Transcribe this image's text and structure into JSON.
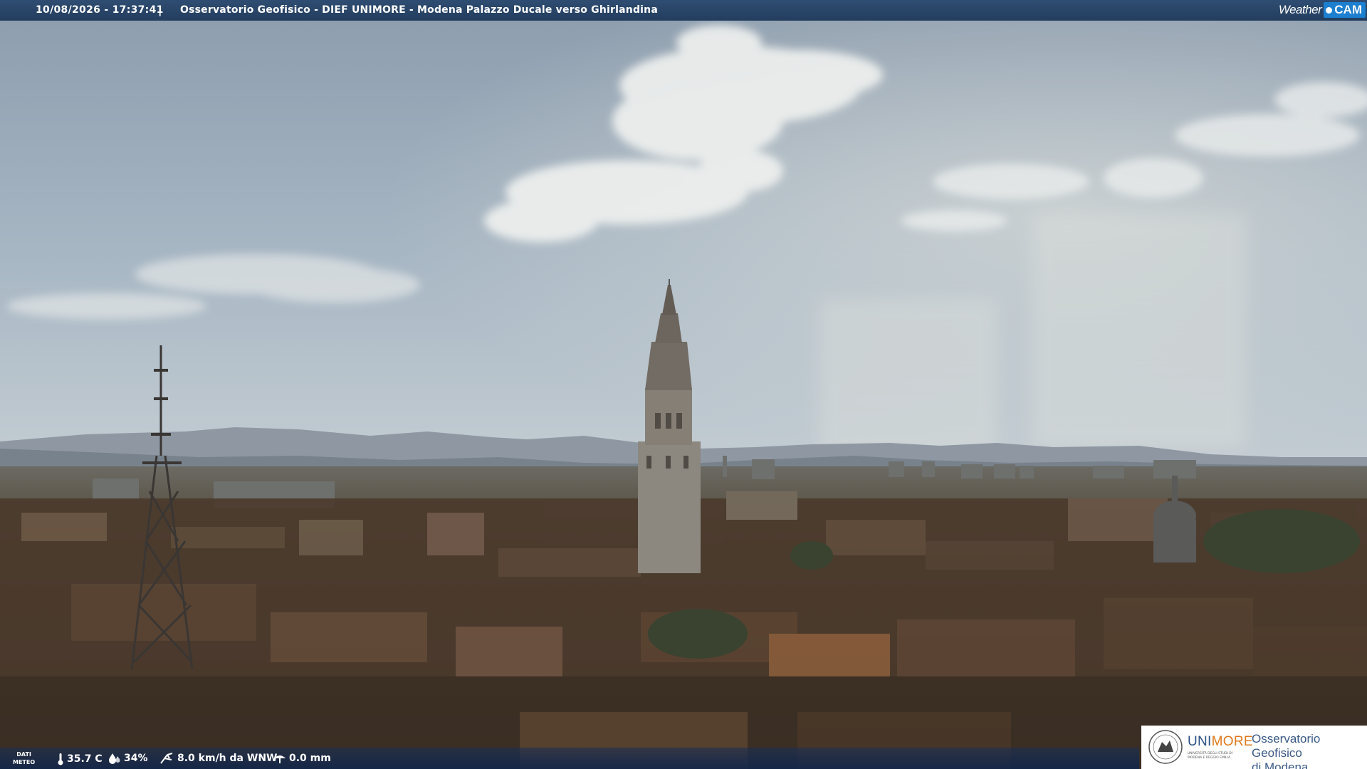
{
  "header": {
    "timestamp": "10/08/2026 - 17:37:41",
    "separator": "|",
    "title": "Osservatorio Geofisico - DIEF UNIMORE - Modena Palazzo Ducale verso Ghirlandina",
    "brand_text": "Weather",
    "brand_cam": "CAM"
  },
  "weather_bar": {
    "label_line1": "DATI",
    "label_line2": "METEO",
    "temperature": "35.7 C",
    "humidity": "34%",
    "wind": "8.0 km/h da WNW",
    "rain": "0.0 mm"
  },
  "institution": {
    "brand_uni": "UNI",
    "brand_more": "MORE",
    "subtitle_line1": "UNIVERSITÀ DEGLI STUDI DI",
    "subtitle_line2": "MODENA E REGGIO EMILIA",
    "name_line1": "Osservatorio Geofisico",
    "name_line2": "di Modena"
  },
  "colors": {
    "header_bg": "#2b4a70",
    "accent_cam": "#1d7fcf",
    "unimore_blue": "#2a4f83",
    "unimore_orange": "#e07a1c"
  },
  "icons": [
    "thermometer-icon",
    "humidity-drop-icon",
    "wind-icon",
    "rain-gauge-icon",
    "university-seal-icon",
    "camera-logo-icon"
  ]
}
